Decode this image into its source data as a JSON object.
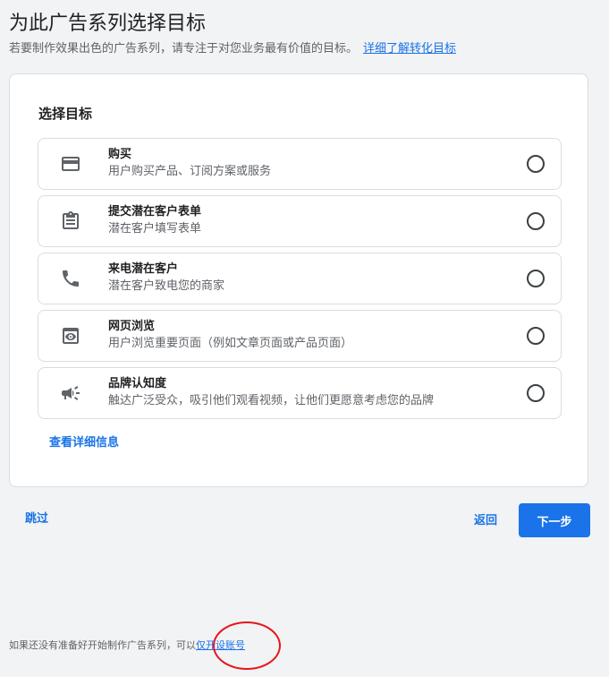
{
  "header": {
    "title": "为此广告系列选择目标",
    "subtitle": "若要制作效果出色的广告系列，请专注于对您业务最有价值的目标。",
    "learn_more_link": "详细了解转化目标"
  },
  "goal_card": {
    "section_title": "选择目标",
    "options": [
      {
        "icon": "credit-card-icon",
        "title": "购买",
        "description": "用户购买产品、订阅方案或服务",
        "selected": false
      },
      {
        "icon": "clipboard-icon",
        "title": "提交潜在客户表单",
        "description": "潜在客户填写表单",
        "selected": false
      },
      {
        "icon": "phone-icon",
        "title": "来电潜在客户",
        "description": "潜在客户致电您的商家",
        "selected": false
      },
      {
        "icon": "webpage-view-icon",
        "title": "网页浏览",
        "description": "用户浏览重要页面（例如文章页面或产品页面）",
        "selected": false
      },
      {
        "icon": "megaphone-icon",
        "title": "品牌认知度",
        "description": "触达广泛受众，吸引他们观看视频，让他们更愿意考虑您的品牌",
        "selected": false
      }
    ],
    "details_link": "查看详细信息"
  },
  "actions": {
    "skip_label": "跳过",
    "back_label": "返回",
    "next_label": "下一步"
  },
  "footer": {
    "note_text": "如果还没有准备好开始制作广告系列，可以",
    "note_link": "仅开设账号"
  },
  "colors": {
    "accent": "#1a73e8",
    "annotation": "#e8141c",
    "background": "#f1f3f4"
  }
}
